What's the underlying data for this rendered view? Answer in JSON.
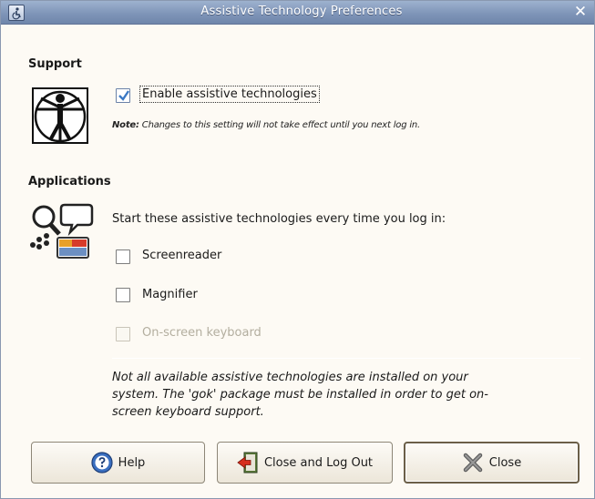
{
  "window": {
    "title": "Assistive Technology Preferences",
    "close_glyph": "✕"
  },
  "support": {
    "heading": "Support",
    "icon": "vitruvian-man-icon",
    "enable_label": "Enable assistive technologies",
    "enable_checked": true,
    "note_prefix": "Note:",
    "note_text": " Changes to this setting will not take effect until you next log in."
  },
  "applications": {
    "heading": "Applications",
    "icon": "accessibility-apps-icon",
    "intro": "Start these assistive technologies every time you log in:",
    "items": [
      {
        "label": "Screenreader",
        "checked": false,
        "enabled": true
      },
      {
        "label": "Magnifier",
        "checked": false,
        "enabled": true
      },
      {
        "label": "On-screen keyboard",
        "checked": false,
        "enabled": false
      }
    ],
    "info": "Not all available assistive technologies are installed on your system.  The 'gok' package must be installed in order to get on-screen keyboard support."
  },
  "buttons": {
    "help": "Help",
    "logout": "Close and Log Out",
    "close": "Close"
  },
  "colors": {
    "titlebar": "#7f95b8",
    "background": "#fdfaf4",
    "check_accent": "#3b78c4"
  }
}
